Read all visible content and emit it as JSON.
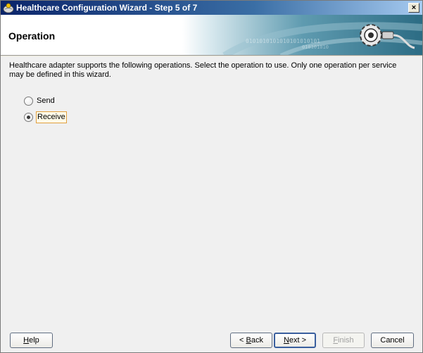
{
  "window": {
    "title": "Healthcare Configuration Wizard - Step 5 of 7",
    "close_label": "×"
  },
  "header": {
    "title": "Operation"
  },
  "content": {
    "description_line1": "Healthcare adapter supports the following operations.  Select the operation to use.  Only one operation per service",
    "description_line2": "may be defined in this wizard.",
    "operations": [
      {
        "label": "Send",
        "selected": false
      },
      {
        "label": "Receive",
        "selected": true
      }
    ]
  },
  "footer": {
    "help": {
      "prefix": "",
      "accel": "H",
      "rest": "elp"
    },
    "back": {
      "prefix": "< ",
      "accel": "B",
      "rest": "ack"
    },
    "next": {
      "prefix": "",
      "accel": "N",
      "rest": "ext >"
    },
    "finish": {
      "prefix": "",
      "accel": "F",
      "rest": "inish"
    },
    "cancel": {
      "label": "Cancel"
    }
  },
  "colors": {
    "title_bar": "#0a246a",
    "banner_accent": "#2e6f86",
    "focus_border": "#e0a040"
  },
  "icons": {
    "app": "oracle-jdeveloper-icon",
    "banner": "gear-plug-icon"
  }
}
